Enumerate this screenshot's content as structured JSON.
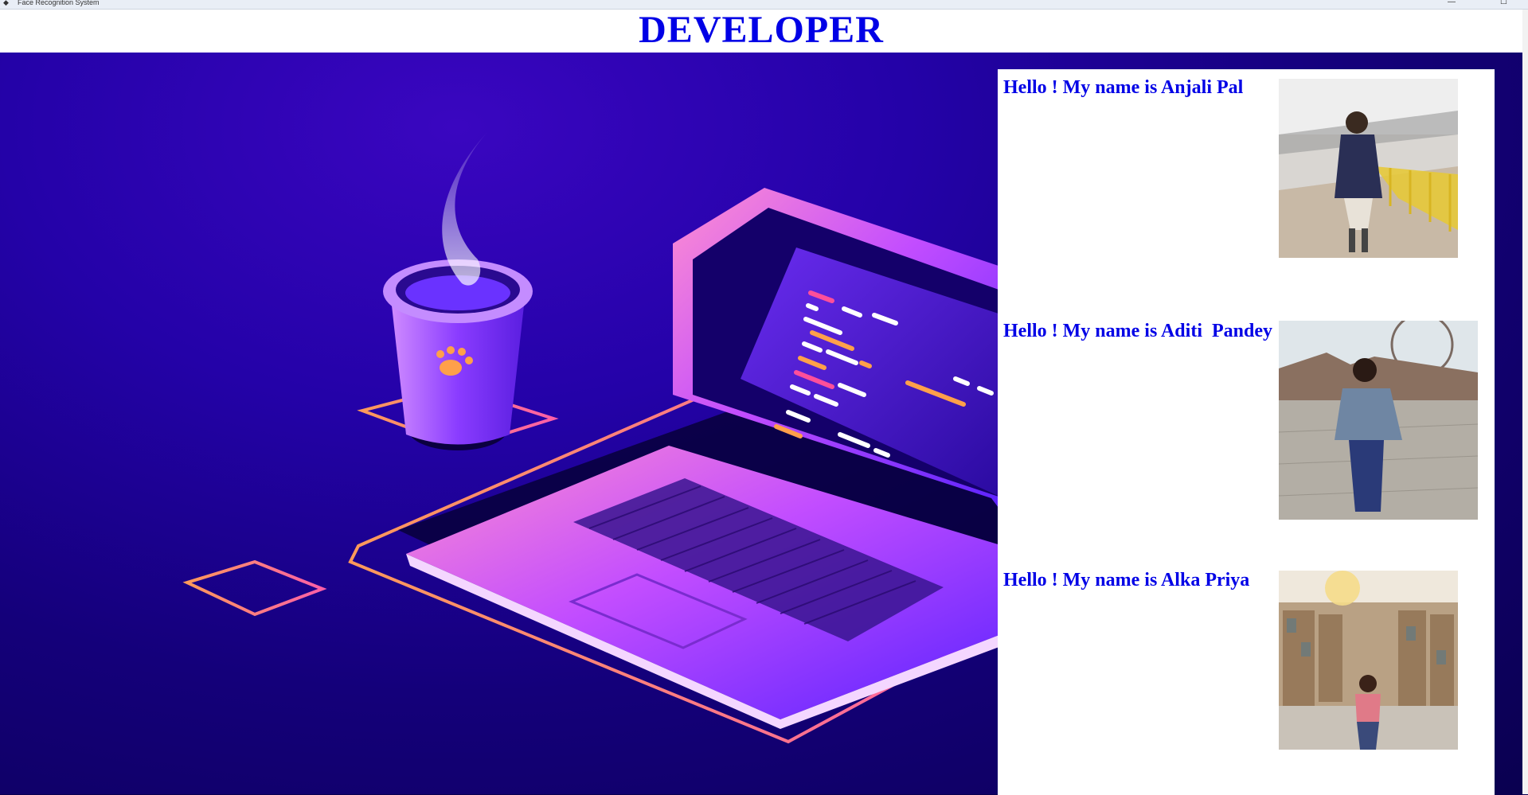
{
  "window": {
    "title": "Face Recognition System",
    "controls": {
      "minimize": "—",
      "maximize": "☐"
    }
  },
  "header": {
    "title": "DEVELOPER"
  },
  "developers": [
    {
      "name_text": "Hello ! My name is Anjali Pal",
      "photo_icon": "person-photo-bridge"
    },
    {
      "name_text": "Hello ! My name is Aditi  Pandey",
      "photo_icon": "person-photo-fair"
    },
    {
      "name_text": "Hello ! My name is Alka Priya",
      "photo_icon": "person-photo-mall"
    }
  ],
  "colors": {
    "accent": "#0000e6",
    "hero_dark": "#0a0050",
    "hero_mid": "#2402a8",
    "neon_orange": "#ff8a5c",
    "neon_pink": "#ff4fd8"
  }
}
